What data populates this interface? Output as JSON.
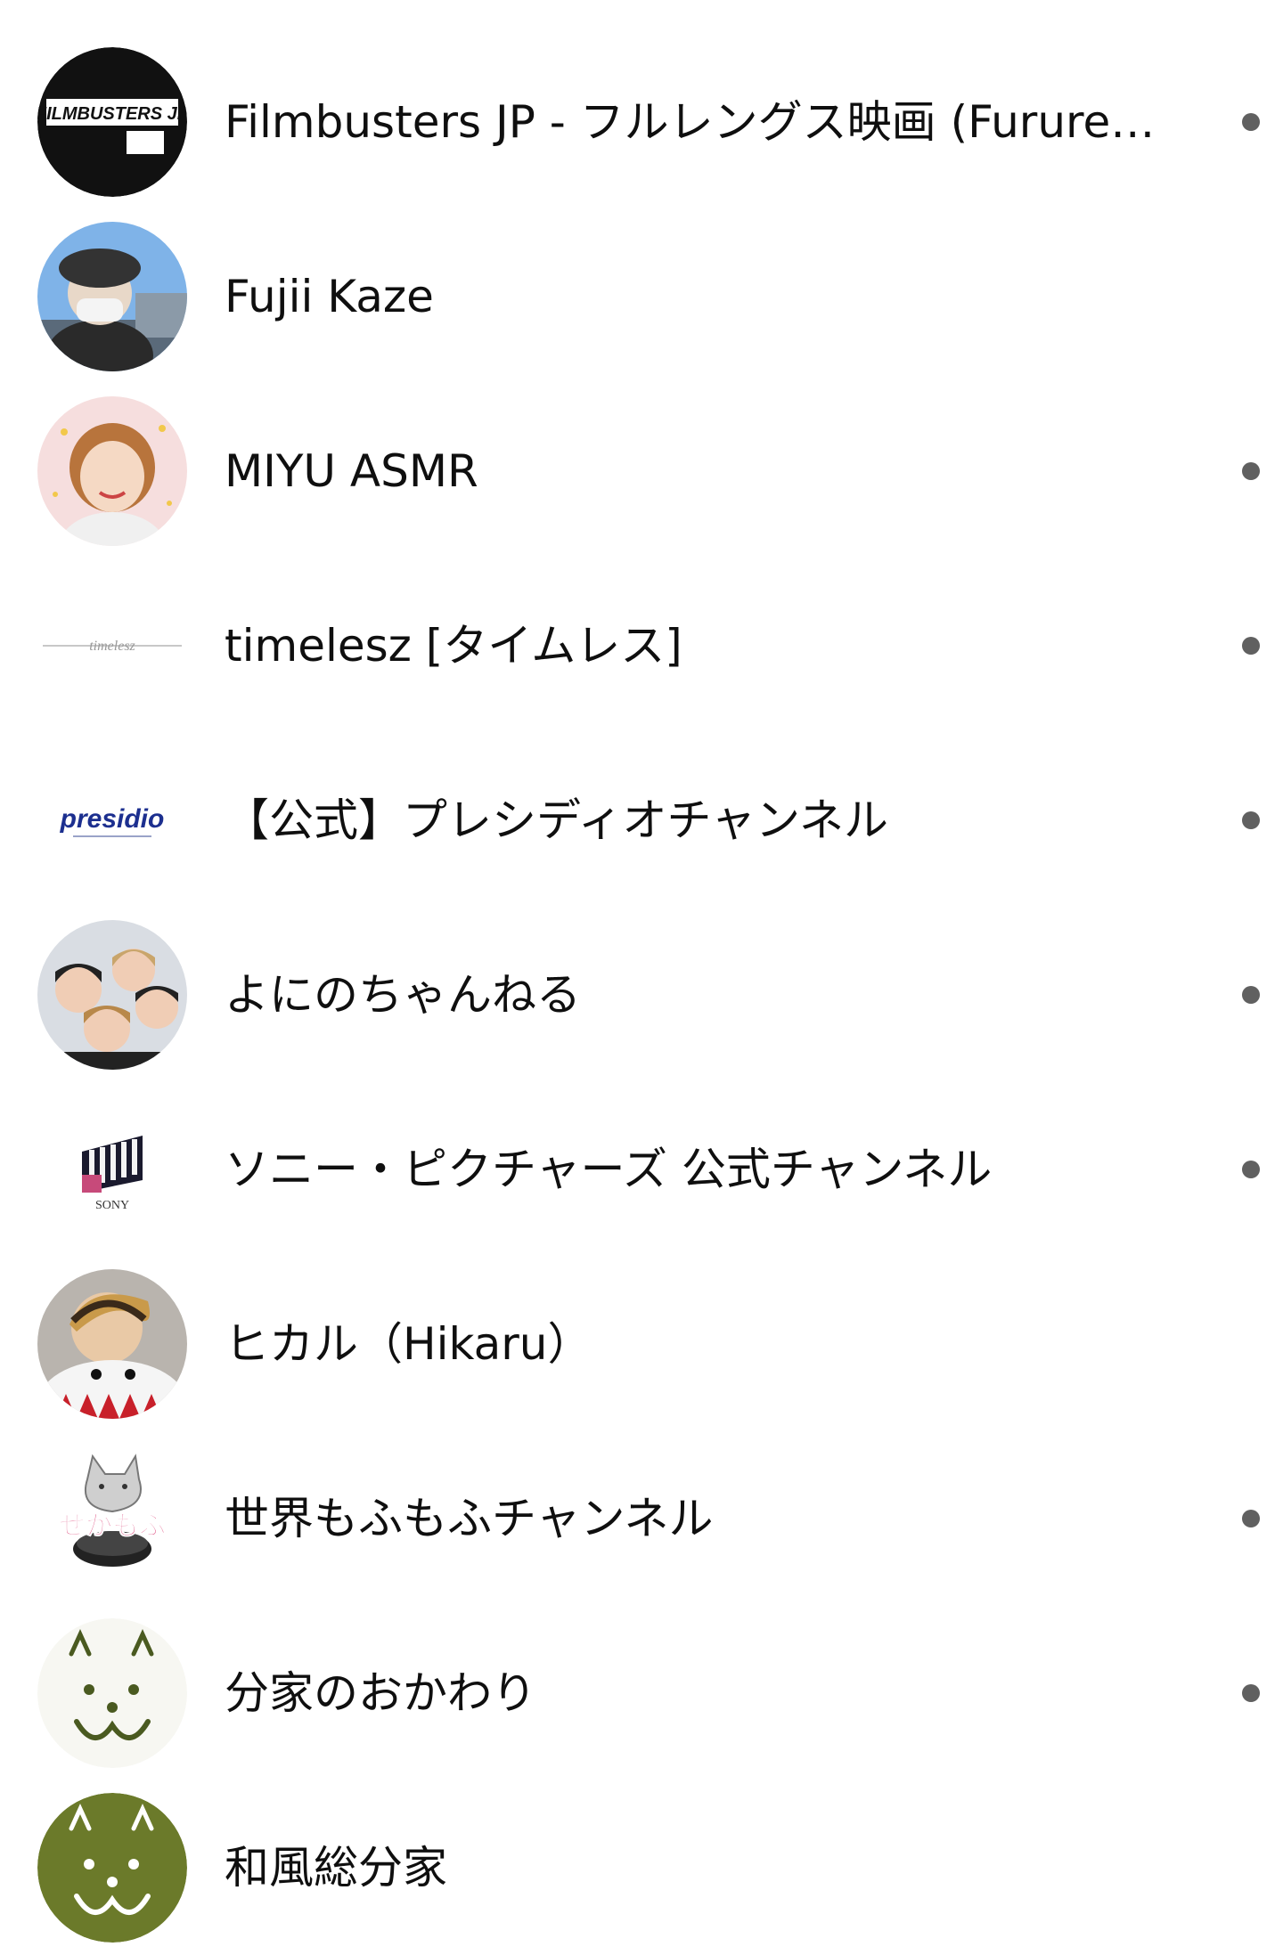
{
  "subscriptions": [
    {
      "name": "Filmbusters JP - フルレングス映画 (Furure…",
      "has_new": true,
      "avatar_text": "FILMBUSTERS JP"
    },
    {
      "name": "Fujii Kaze",
      "has_new": false
    },
    {
      "name": "MIYU ASMR",
      "has_new": true
    },
    {
      "name": "timelesz [タイムレス]",
      "has_new": true,
      "avatar_text": "timelesz"
    },
    {
      "name": "【公式】プレシディオチャンネル",
      "has_new": true,
      "avatar_text": "presidio"
    },
    {
      "name": "よにのちゃんねる",
      "has_new": true
    },
    {
      "name": "ソニー・ピクチャーズ 公式チャンネル",
      "has_new": true,
      "avatar_text": "SONY"
    },
    {
      "name": "ヒカル（Hikaru）",
      "has_new": false
    },
    {
      "name": "世界もふもふチャンネル",
      "has_new": true,
      "avatar_text": "せかもふ"
    },
    {
      "name": "分家のおかわり",
      "has_new": true
    },
    {
      "name": "和風総分家",
      "has_new": false
    }
  ],
  "colors": {
    "text": "#0f0f0f",
    "new_dot": "#606060",
    "background": "#ffffff",
    "wafu_green": "#6b7a2a"
  }
}
